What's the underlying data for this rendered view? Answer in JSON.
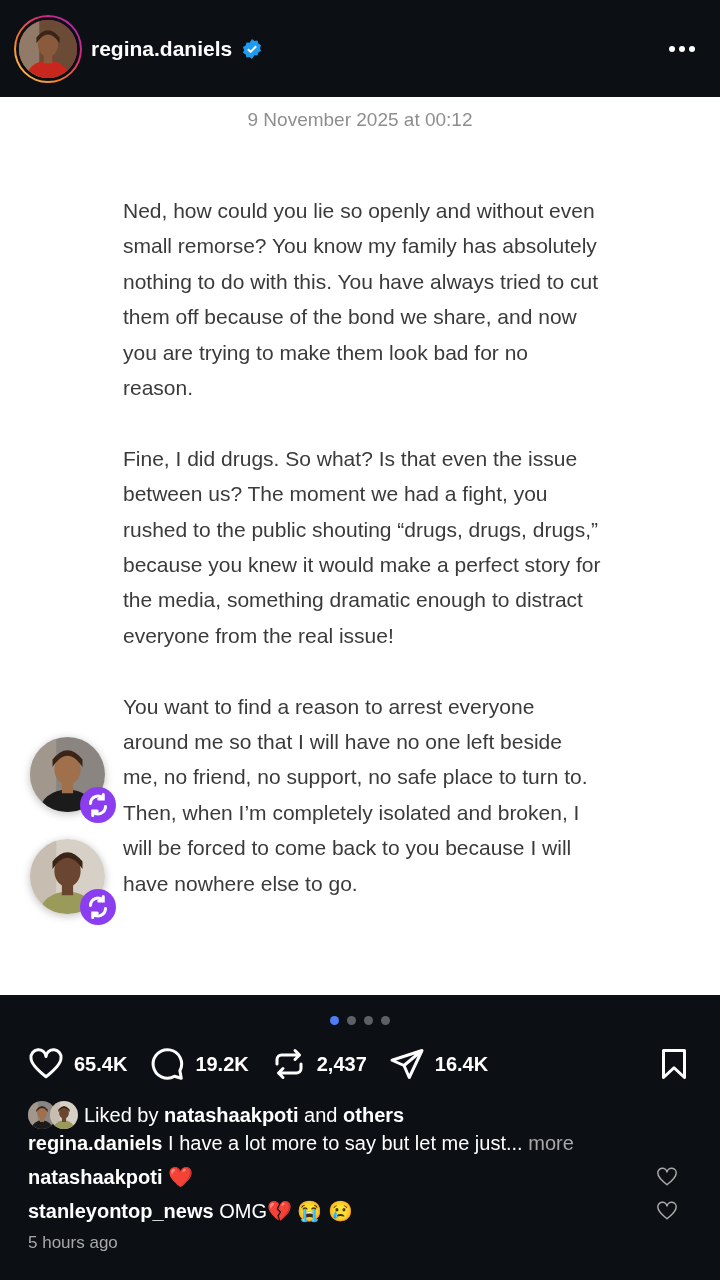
{
  "header": {
    "username": "regina.daniels",
    "verified": true
  },
  "post": {
    "date": "9 November 2025 at 00:12",
    "paragraphs": [
      "Ned, how could you lie so openly and without even small remorse? You know my family has absolutely nothing to do with this. You have always tried to cut them off because of the bond we share, and now you are trying to make them look bad for no reason.",
      "Fine, I did drugs. So what? Is that even the issue between us? The moment we had a fight, you rushed to the public shouting “drugs, drugs, drugs,” because you knew it would make a perfect story for the media, something dramatic enough to distract everyone from the real issue!",
      "You want to find a reason to arrest everyone around me so that I will have no one left beside me, no friend, no support, no safe place to turn to. Then, when I’m completely isolated and broken, I will be forced to come back to you because I will have nowhere else to go."
    ]
  },
  "carousel": [
    {
      "selected": true
    },
    {
      "selected": false
    },
    {
      "selected": false
    },
    {
      "selected": false
    }
  ],
  "actions": [
    {
      "kind": "like",
      "count": "65.4K"
    },
    {
      "kind": "comment",
      "count": "19.2K"
    },
    {
      "kind": "repost",
      "count": "2,437"
    },
    {
      "kind": "share",
      "count": "16.4K"
    }
  ],
  "liked_by": {
    "prefix": "Liked by",
    "user": "natashaakpoti",
    "joiner": "and",
    "others": "others"
  },
  "caption": {
    "username": "regina.daniels",
    "text": "I have a lot more to say but let me just...",
    "more": "more"
  },
  "comments": [
    {
      "username": "natashaakpoti",
      "text": "❤️"
    },
    {
      "username": "stanleyontop_news",
      "text": "OMG💔 😭 😢"
    }
  ],
  "time": "5 hours ago"
}
